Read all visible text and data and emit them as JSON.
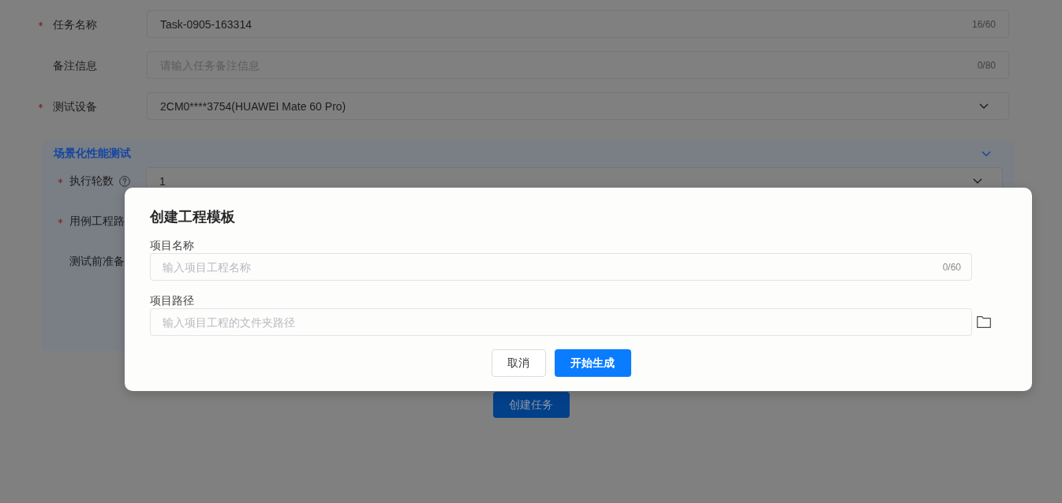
{
  "form": {
    "fields": [
      {
        "kind": "text",
        "label": "任务名称",
        "required": true,
        "value": "Task-0905-163314",
        "counter": "16/60"
      },
      {
        "kind": "text",
        "label": "备注信息",
        "required": false,
        "placeholder": "请输入任务备注信息",
        "counter": "0/80"
      },
      {
        "kind": "select",
        "label": "测试设备",
        "required": true,
        "value": "2CM0****3754(HUAWEI Mate 60 Pro)"
      }
    ]
  },
  "section": {
    "title": "场景化性能测试",
    "expanded": true,
    "fields": [
      {
        "kind": "select",
        "label": "执行轮数",
        "required": true,
        "help": true,
        "value": "1"
      },
      {
        "kind": "label_only",
        "label": "用例工程路",
        "required": true,
        "help": false
      },
      {
        "kind": "label_only",
        "label": "测试前准备",
        "required": false,
        "help": false
      }
    ]
  },
  "submit_button": "创建任务",
  "dialog": {
    "title": "创建工程模板",
    "fields": [
      {
        "kind": "text",
        "label": "项目名称",
        "placeholder": "输入项目工程名称",
        "counter": "0/60"
      },
      {
        "kind": "path",
        "label": "项目路径",
        "placeholder": "输入项目工程的文件夹路径"
      }
    ],
    "buttons": [
      {
        "kind": "secondary",
        "label": "取消"
      },
      {
        "kind": "primary",
        "label": "开始生成"
      }
    ]
  }
}
